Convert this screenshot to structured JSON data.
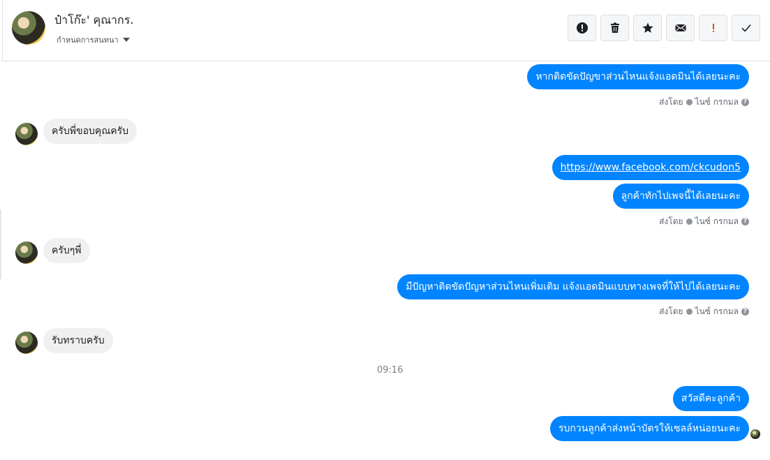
{
  "header": {
    "name": "ป๋าโก๊ะ' คุณากร.",
    "subtitle": "กำหนดการสนทนา",
    "tools": [
      {
        "icon": "alert-circle-icon",
        "name": "mark-spam-button"
      },
      {
        "icon": "trash-icon",
        "name": "delete-button"
      },
      {
        "icon": "star-icon",
        "name": "star-button"
      },
      {
        "icon": "envelope-icon",
        "name": "mark-unread-button"
      },
      {
        "icon": "exclamation-icon",
        "name": "follow-up-button"
      },
      {
        "icon": "check-icon",
        "name": "mark-done-button"
      }
    ]
  },
  "messages": {
    "m1": "หากติดขัดปัญขาส่วนไหนแจ้งแอดมินได้เลยนะคะ",
    "m2": "ครับพี่ขอบคุณครับ",
    "m3": "https://www.facebook.com/ckcudon5",
    "m4": "ลูกค้าทักไปเพจนี้ได้เลยนะคะ",
    "m5": "ครับๆพี่",
    "m6": "มีปัญหาติดขัดปัญหาส่วนไหนเพิ่มเติม  แจ้งแอดมินแบบทางเพจที่ให้ไปได้เลยนะคะ",
    "m7": "รับทราบครับ",
    "m8": "สวัสดีคะลูกค้า",
    "m9": "รบกวนลูกค้าส่งหน้าบัตรให้เซลล์หน่อยนะคะ"
  },
  "status": {
    "sent_by": "ส่งโดย",
    "sender": "ไนซ์ กรกมล"
  },
  "timestamp": "09:16",
  "colors": {
    "outgoing": "#0084ff",
    "incoming": "#f1f0f0"
  }
}
